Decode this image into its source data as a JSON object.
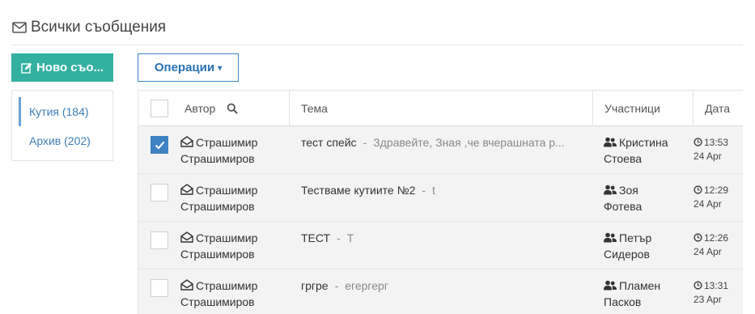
{
  "header": {
    "title": "Всички съобщения",
    "icon": "envelope-icon"
  },
  "compose": {
    "label": "Ново съо..."
  },
  "folders": [
    {
      "label": "Кутия (184)",
      "active": true
    },
    {
      "label": "Архив (202)",
      "active": false
    }
  ],
  "operations": {
    "label": "Операции"
  },
  "table": {
    "columns": {
      "author": "Автор",
      "subject": "Тема",
      "participants": "Участници",
      "date": "Дата"
    },
    "rows": [
      {
        "checked": true,
        "author_first": "Страшимир",
        "author_last": "Страшимиров",
        "subject": "тест спейс",
        "preview": "Здравейте, Зная ,че вчерашната р...",
        "participant_first": "Кристина",
        "participant_last": "Стоева",
        "time": "13:53",
        "day": "24 Apr"
      },
      {
        "checked": false,
        "author_first": "Страшимир",
        "author_last": "Страшимиров",
        "subject": "Тестваме кутиите №2",
        "preview": "t",
        "participant_first": "Зоя",
        "participant_last": "Фотева",
        "time": "12:29",
        "day": "24 Apr"
      },
      {
        "checked": false,
        "author_first": "Страшимир",
        "author_last": "Страшимиров",
        "subject": "ТЕСТ",
        "preview": "Т",
        "participant_first": "Петър",
        "participant_last": "Сидеров",
        "time": "12:26",
        "day": "24 Apr"
      },
      {
        "checked": false,
        "author_first": "Страшимир",
        "author_last": "Страшимиров",
        "subject": "гргре",
        "preview": "егергерг",
        "participant_first": "Пламен",
        "participant_last": "Пасков",
        "time": "13:31",
        "day": "23 Apr"
      }
    ]
  },
  "colors": {
    "accent": "#33b0a0",
    "primary": "#3e82c3",
    "link": "#3d7db8",
    "row_bg": "#f3f3f3"
  }
}
